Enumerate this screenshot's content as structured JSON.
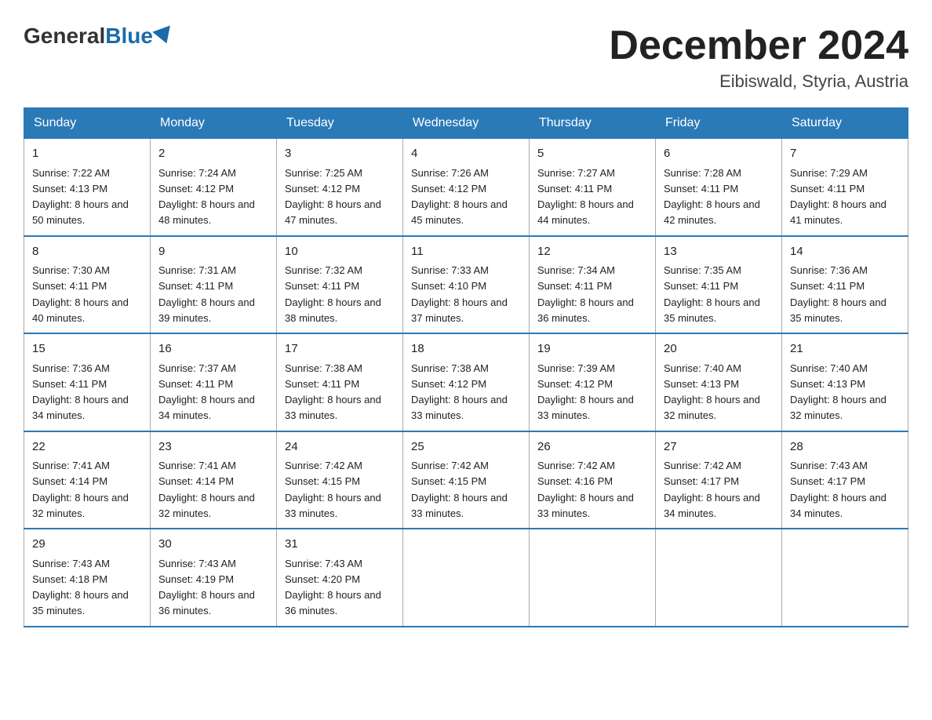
{
  "logo": {
    "general": "General",
    "blue": "Blue"
  },
  "title": {
    "month_year": "December 2024",
    "location": "Eibiswald, Styria, Austria"
  },
  "headers": [
    "Sunday",
    "Monday",
    "Tuesday",
    "Wednesday",
    "Thursday",
    "Friday",
    "Saturday"
  ],
  "weeks": [
    [
      {
        "day": "1",
        "sunrise": "7:22 AM",
        "sunset": "4:13 PM",
        "daylight": "8 hours and 50 minutes."
      },
      {
        "day": "2",
        "sunrise": "7:24 AM",
        "sunset": "4:12 PM",
        "daylight": "8 hours and 48 minutes."
      },
      {
        "day": "3",
        "sunrise": "7:25 AM",
        "sunset": "4:12 PM",
        "daylight": "8 hours and 47 minutes."
      },
      {
        "day": "4",
        "sunrise": "7:26 AM",
        "sunset": "4:12 PM",
        "daylight": "8 hours and 45 minutes."
      },
      {
        "day": "5",
        "sunrise": "7:27 AM",
        "sunset": "4:11 PM",
        "daylight": "8 hours and 44 minutes."
      },
      {
        "day": "6",
        "sunrise": "7:28 AM",
        "sunset": "4:11 PM",
        "daylight": "8 hours and 42 minutes."
      },
      {
        "day": "7",
        "sunrise": "7:29 AM",
        "sunset": "4:11 PM",
        "daylight": "8 hours and 41 minutes."
      }
    ],
    [
      {
        "day": "8",
        "sunrise": "7:30 AM",
        "sunset": "4:11 PM",
        "daylight": "8 hours and 40 minutes."
      },
      {
        "day": "9",
        "sunrise": "7:31 AM",
        "sunset": "4:11 PM",
        "daylight": "8 hours and 39 minutes."
      },
      {
        "day": "10",
        "sunrise": "7:32 AM",
        "sunset": "4:11 PM",
        "daylight": "8 hours and 38 minutes."
      },
      {
        "day": "11",
        "sunrise": "7:33 AM",
        "sunset": "4:10 PM",
        "daylight": "8 hours and 37 minutes."
      },
      {
        "day": "12",
        "sunrise": "7:34 AM",
        "sunset": "4:11 PM",
        "daylight": "8 hours and 36 minutes."
      },
      {
        "day": "13",
        "sunrise": "7:35 AM",
        "sunset": "4:11 PM",
        "daylight": "8 hours and 35 minutes."
      },
      {
        "day": "14",
        "sunrise": "7:36 AM",
        "sunset": "4:11 PM",
        "daylight": "8 hours and 35 minutes."
      }
    ],
    [
      {
        "day": "15",
        "sunrise": "7:36 AM",
        "sunset": "4:11 PM",
        "daylight": "8 hours and 34 minutes."
      },
      {
        "day": "16",
        "sunrise": "7:37 AM",
        "sunset": "4:11 PM",
        "daylight": "8 hours and 34 minutes."
      },
      {
        "day": "17",
        "sunrise": "7:38 AM",
        "sunset": "4:11 PM",
        "daylight": "8 hours and 33 minutes."
      },
      {
        "day": "18",
        "sunrise": "7:38 AM",
        "sunset": "4:12 PM",
        "daylight": "8 hours and 33 minutes."
      },
      {
        "day": "19",
        "sunrise": "7:39 AM",
        "sunset": "4:12 PM",
        "daylight": "8 hours and 33 minutes."
      },
      {
        "day": "20",
        "sunrise": "7:40 AM",
        "sunset": "4:13 PM",
        "daylight": "8 hours and 32 minutes."
      },
      {
        "day": "21",
        "sunrise": "7:40 AM",
        "sunset": "4:13 PM",
        "daylight": "8 hours and 32 minutes."
      }
    ],
    [
      {
        "day": "22",
        "sunrise": "7:41 AM",
        "sunset": "4:14 PM",
        "daylight": "8 hours and 32 minutes."
      },
      {
        "day": "23",
        "sunrise": "7:41 AM",
        "sunset": "4:14 PM",
        "daylight": "8 hours and 32 minutes."
      },
      {
        "day": "24",
        "sunrise": "7:42 AM",
        "sunset": "4:15 PM",
        "daylight": "8 hours and 33 minutes."
      },
      {
        "day": "25",
        "sunrise": "7:42 AM",
        "sunset": "4:15 PM",
        "daylight": "8 hours and 33 minutes."
      },
      {
        "day": "26",
        "sunrise": "7:42 AM",
        "sunset": "4:16 PM",
        "daylight": "8 hours and 33 minutes."
      },
      {
        "day": "27",
        "sunrise": "7:42 AM",
        "sunset": "4:17 PM",
        "daylight": "8 hours and 34 minutes."
      },
      {
        "day": "28",
        "sunrise": "7:43 AM",
        "sunset": "4:17 PM",
        "daylight": "8 hours and 34 minutes."
      }
    ],
    [
      {
        "day": "29",
        "sunrise": "7:43 AM",
        "sunset": "4:18 PM",
        "daylight": "8 hours and 35 minutes."
      },
      {
        "day": "30",
        "sunrise": "7:43 AM",
        "sunset": "4:19 PM",
        "daylight": "8 hours and 36 minutes."
      },
      {
        "day": "31",
        "sunrise": "7:43 AM",
        "sunset": "4:20 PM",
        "daylight": "8 hours and 36 minutes."
      },
      null,
      null,
      null,
      null
    ]
  ]
}
